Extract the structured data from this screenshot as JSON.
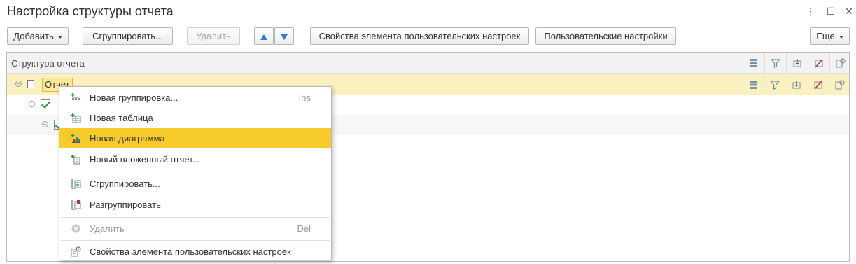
{
  "window": {
    "title": "Настройка структуры отчета",
    "controls": {
      "more": "⋮",
      "maximize": "☐",
      "close": "✕"
    }
  },
  "toolbar": {
    "add_label": "Добавить",
    "group_label": "Сгруппировать...",
    "delete_label": "Удалить",
    "move_up_icon": "arrow-up-icon",
    "move_down_icon": "arrow-down-icon",
    "element_props_label": "Свойства элемента пользовательских настроек",
    "user_settings_label": "Пользовательские настройки",
    "more_label": "Еще"
  },
  "tree": {
    "header": "Структура отчета",
    "column_icons": [
      "fields-icon",
      "filter-icon",
      "order-icon",
      "conditional-format-icon",
      "properties-icon"
    ],
    "rows": [
      {
        "label": "Отчет",
        "selected": true,
        "level": 0
      },
      {
        "label": "",
        "checked": true,
        "level": 1
      },
      {
        "label": "",
        "checked": true,
        "level": 2
      }
    ]
  },
  "context_menu": {
    "items": [
      {
        "label": "Новая группировка...",
        "shortcut": "Ins",
        "icon": "new-grouping-icon"
      },
      {
        "label": "Новая таблица",
        "shortcut": "",
        "icon": "new-table-icon"
      },
      {
        "label": "Новая диаграмма",
        "shortcut": "",
        "icon": "new-chart-icon",
        "highlighted": true
      },
      {
        "label": "Новый вложенный отчет...",
        "shortcut": "",
        "icon": "new-nested-report-icon"
      },
      {
        "label": "Сгруппировать...",
        "shortcut": "",
        "icon": "group-icon"
      },
      {
        "label": "Разгруппировать",
        "shortcut": "",
        "icon": "ungroup-icon"
      },
      {
        "label": "Удалить",
        "shortcut": "Del",
        "icon": "delete-icon",
        "disabled": true
      },
      {
        "label": "Свойства элемента пользовательских настроек",
        "shortcut": "",
        "icon": "element-settings-icon"
      }
    ]
  },
  "colors": {
    "highlight": "#f7cc2a",
    "selected_row": "#fbf0c0",
    "check": "#1e9a2e",
    "arrow": "#2e7dd8"
  }
}
